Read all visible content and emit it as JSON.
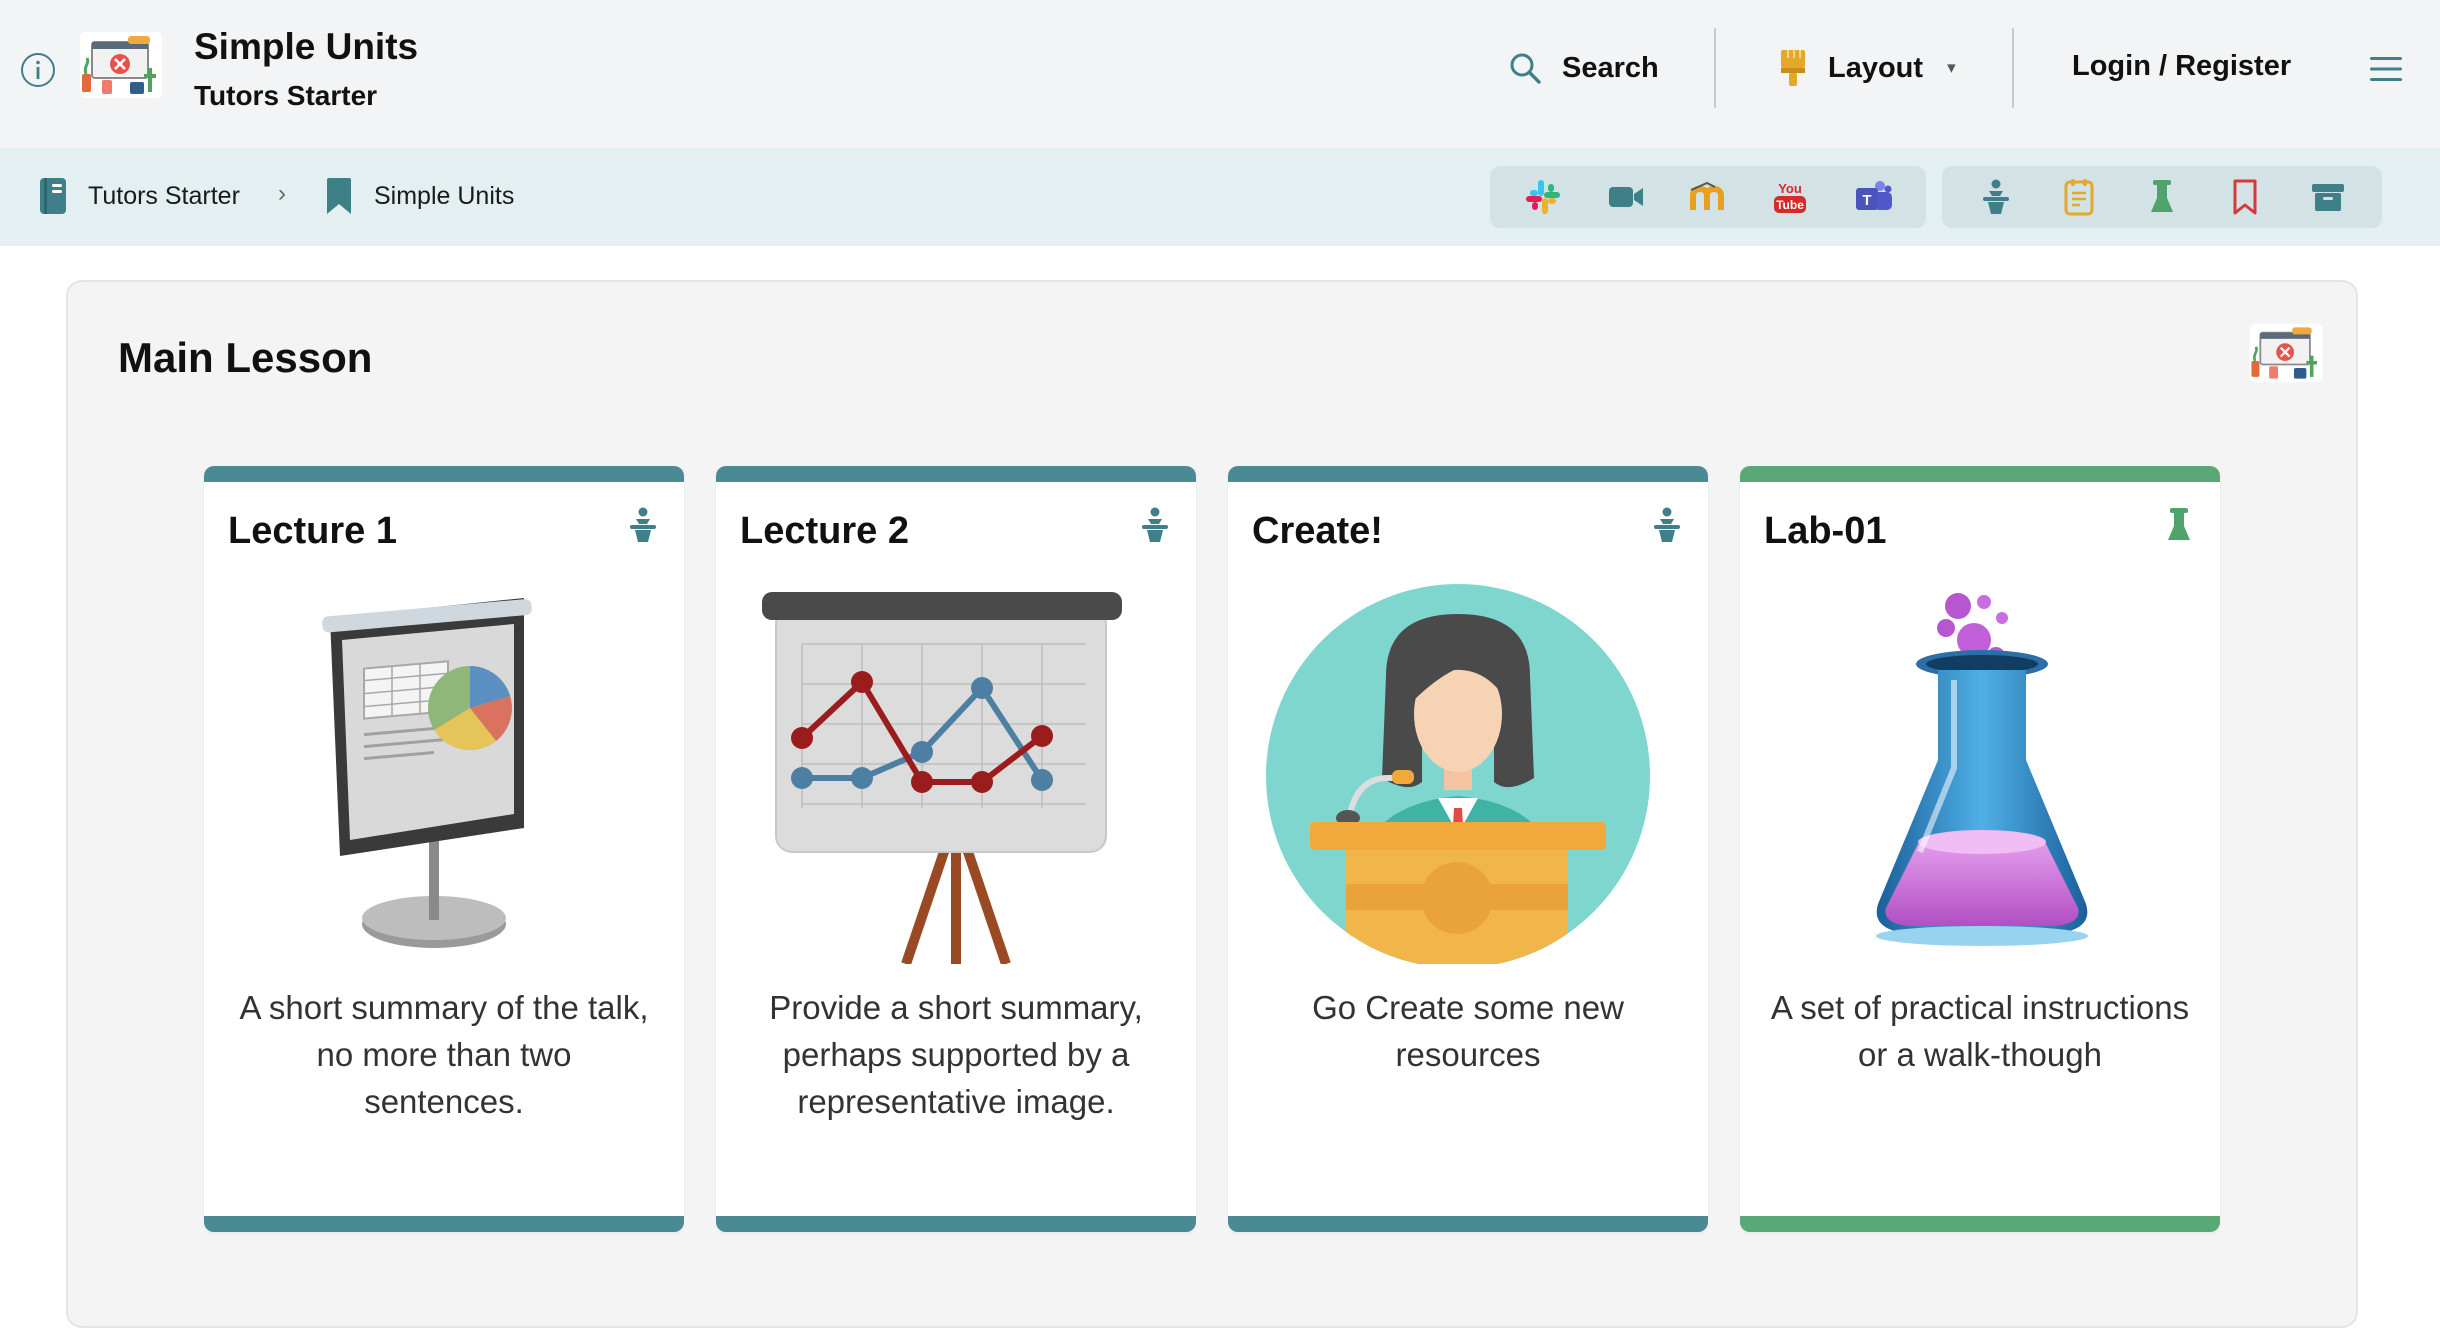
{
  "header": {
    "info_icon": "info-circle-icon",
    "logo": "course-logo",
    "title": "Simple Units",
    "subtitle": "Tutors Starter",
    "search_label": "Search",
    "layout_label": "Layout",
    "layout_caret": "▾",
    "login_label": "Login / Register",
    "menu_icon": "hamburger-menu-icon"
  },
  "breadcrumb": {
    "items": [
      {
        "label": "Tutors Starter",
        "icon": "course-book-icon"
      },
      {
        "label": "Simple Units",
        "icon": "bookmark-icon"
      }
    ],
    "separator": "›"
  },
  "toolbar": {
    "external": [
      "slack-icon",
      "video-icon",
      "moodle-icon",
      "youtube-icon",
      "teams-icon"
    ],
    "internal": [
      "lecture-icon",
      "notes-icon",
      "lab-icon",
      "bookmark-icon",
      "archive-icon"
    ]
  },
  "main": {
    "title": "Main Lesson",
    "cards": [
      {
        "title": "Lecture 1",
        "type": "lecture",
        "description": "A short summary of the talk, no more than two sentences.",
        "bar_color": "#4a8a92"
      },
      {
        "title": "Lecture 2",
        "type": "lecture",
        "description": "Provide a short summary, perhaps supported by a representative image.",
        "bar_color": "#4a8a92"
      },
      {
        "title": "Create!",
        "type": "lecture",
        "description": "Go Create some new resources",
        "bar_color": "#4a8a92"
      },
      {
        "title": "Lab-01",
        "type": "lab",
        "description": "A set of practical instructions or a walk-though",
        "bar_color": "#5aa876"
      }
    ]
  },
  "colors": {
    "teal": "#4a8a92",
    "green": "#5aa876",
    "header_bg": "#f3f4f5",
    "crumb_bg": "#e4eff1"
  }
}
